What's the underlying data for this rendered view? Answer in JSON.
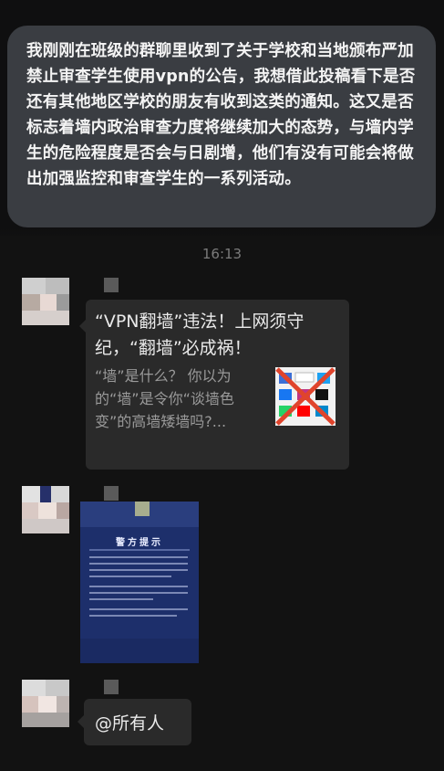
{
  "post": {
    "text": "我刚刚在班级的群聊里收到了关于学校和当地颁布严加禁止审查学生使用vpn的公告，我想借此投稿看下是否还有其他地区学校的朋友有收到这类的通知。这又是否标志着墙内政治审查力度将继续加大的态势，与墙内学生的危险程度是否会与日剧增，他们有没有可能会将做出加强监控和审查学生的一系列活动。"
  },
  "chat": {
    "time": "16:13",
    "link_message": {
      "title": "“VPN翻墙”违法！上网须守纪，“翻墙”必成祸！",
      "description": "“墙”是什么？ 你以为的“墙”是令你“谈墙色变”的高墙矮墙吗?...",
      "thumbnail_icon": "blocked-apps-thumbnail"
    },
    "image_message": {
      "heading": "警方提示"
    },
    "mention_message": {
      "text": "@所有人"
    }
  },
  "colors": {
    "page_bg": "#0f0f10",
    "post_card_bg": "#3a3d42",
    "bubble_bg": "#2a2a2a",
    "notice_blue": "#1d2f6b",
    "cross_red": "#e0442c"
  }
}
